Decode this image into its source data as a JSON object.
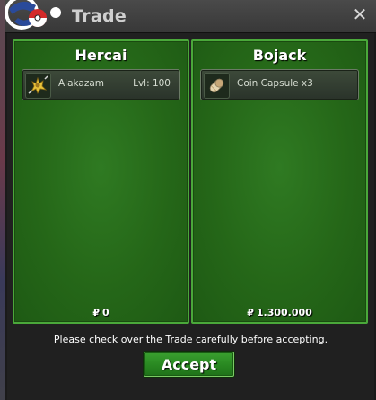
{
  "window": {
    "title": "Trade",
    "close_icon": "close-icon",
    "logo_icon": "pokeball-logo-icon"
  },
  "trade": {
    "left": {
      "player_name": "Hercai",
      "items": [
        {
          "icon": "alakazam-sprite-icon",
          "name": "Alakazam",
          "level": "Lvl: 100"
        }
      ],
      "currency_symbol": "₽",
      "money": "0"
    },
    "right": {
      "player_name": "Bojack",
      "items": [
        {
          "icon": "coin-capsule-icon",
          "name": "Coin Capsule  x3",
          "level": ""
        }
      ],
      "currency_symbol": "₽",
      "money": "1.300.000"
    }
  },
  "footer": {
    "notice": "Please check over the Trade carefully before accepting.",
    "accept_label": "Accept"
  },
  "colors": {
    "panel_green": "#256718",
    "panel_border": "#4aa83a",
    "button_green": "#2a8a22"
  }
}
